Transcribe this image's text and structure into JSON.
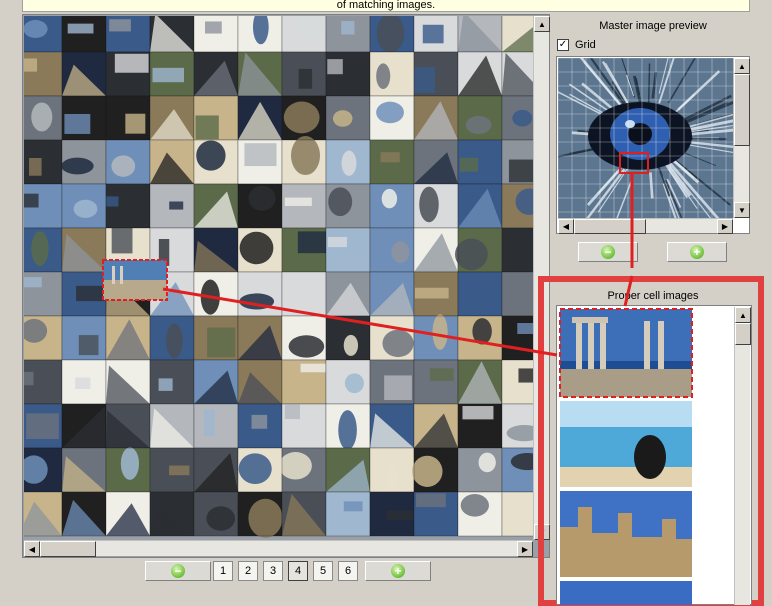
{
  "hint": {
    "text": "of matching images."
  },
  "preview": {
    "title": "Master image preview",
    "grid_label": "Grid",
    "grid_checked": true,
    "zoom_out_icon": "minus-icon",
    "zoom_in_icon": "plus-icon"
  },
  "cells": {
    "title": "Proper cell images",
    "items": [
      {
        "name": "temple-columns-photo"
      },
      {
        "name": "beach-woman-photo"
      },
      {
        "name": "castle-photo"
      }
    ]
  },
  "pager": {
    "pages": [
      "1",
      "2",
      "3",
      "4",
      "5",
      "6"
    ],
    "active_page": "4",
    "zoom_out_icon": "minus-icon",
    "zoom_in_icon": "plus-icon"
  },
  "colors": {
    "highlight": "#e02020",
    "frame": "#e04040",
    "button_green": "#6fbf3a"
  },
  "icons": {
    "scroll_up": "▲",
    "scroll_down": "▼",
    "scroll_left": "◀",
    "scroll_right": "▶",
    "check": "✓"
  }
}
